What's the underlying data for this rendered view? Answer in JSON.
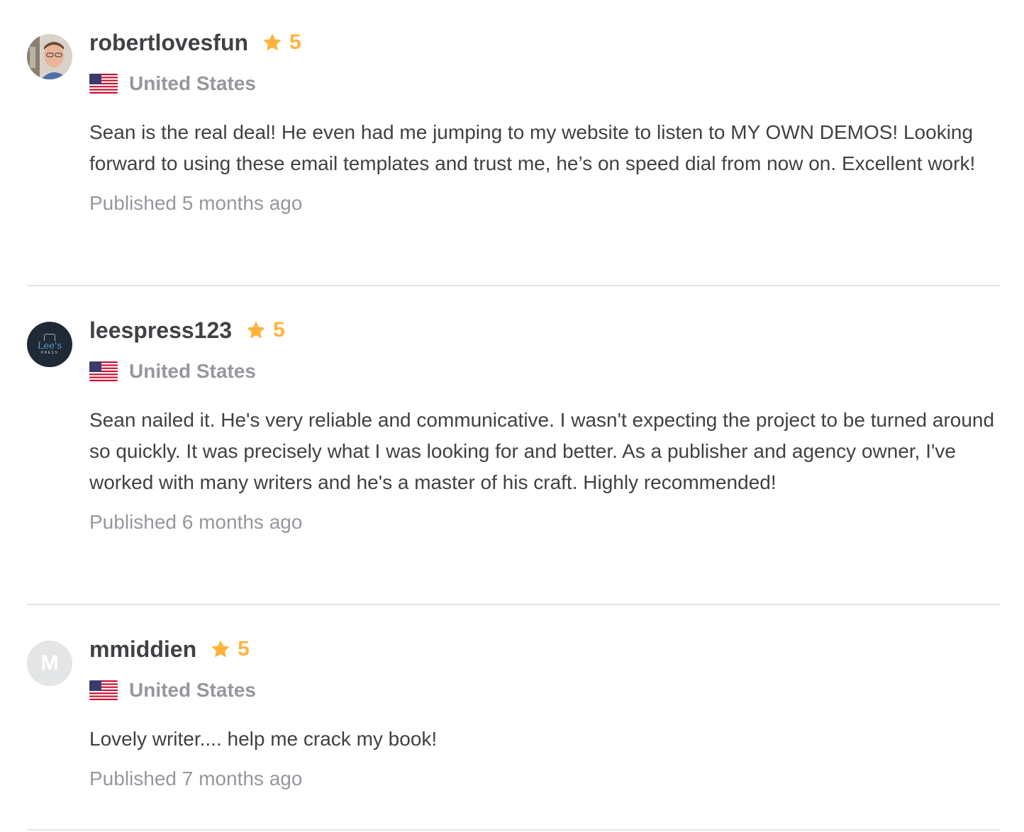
{
  "reviews": [
    {
      "username": "robertlovesfun",
      "rating": "5",
      "country": "United States",
      "avatar": "photo",
      "text": "Sean is the real deal! He even had me jumping to my website to listen to MY OWN DEMOS! Looking forward to using these email templates and trust me, he’s on speed dial from now on. Excellent work!",
      "published": "Published 5 months ago"
    },
    {
      "username": "leespress123",
      "rating": "5",
      "country": "United States",
      "avatar": "brand-logo",
      "avatar_text": {
        "name": "Lee's",
        "sub": "PRESS"
      },
      "text": "Sean nailed it. He's very reliable and communicative. I wasn't expecting the project to be turned around so quickly. It was precisely what I was looking for and better. As a publisher and agency owner, I've worked with many writers and he's a master of his craft. Highly recommended!",
      "published": "Published 6 months ago"
    },
    {
      "username": "mmiddien",
      "rating": "5",
      "country": "United States",
      "avatar": "initial",
      "avatar_initial": "M",
      "text": "Lovely writer.... help me crack my book!",
      "published": "Published 7 months ago"
    }
  ],
  "icons": {
    "rating": "star-icon",
    "country": "us-flag-icon"
  },
  "colors": {
    "star": "#ffb33e",
    "text": "#404145",
    "muted": "#95979d",
    "divider": "#e4e5e7",
    "brand_avatar_bg": "#1f2a36",
    "initial_avatar_bg": "#e4e5e7"
  }
}
